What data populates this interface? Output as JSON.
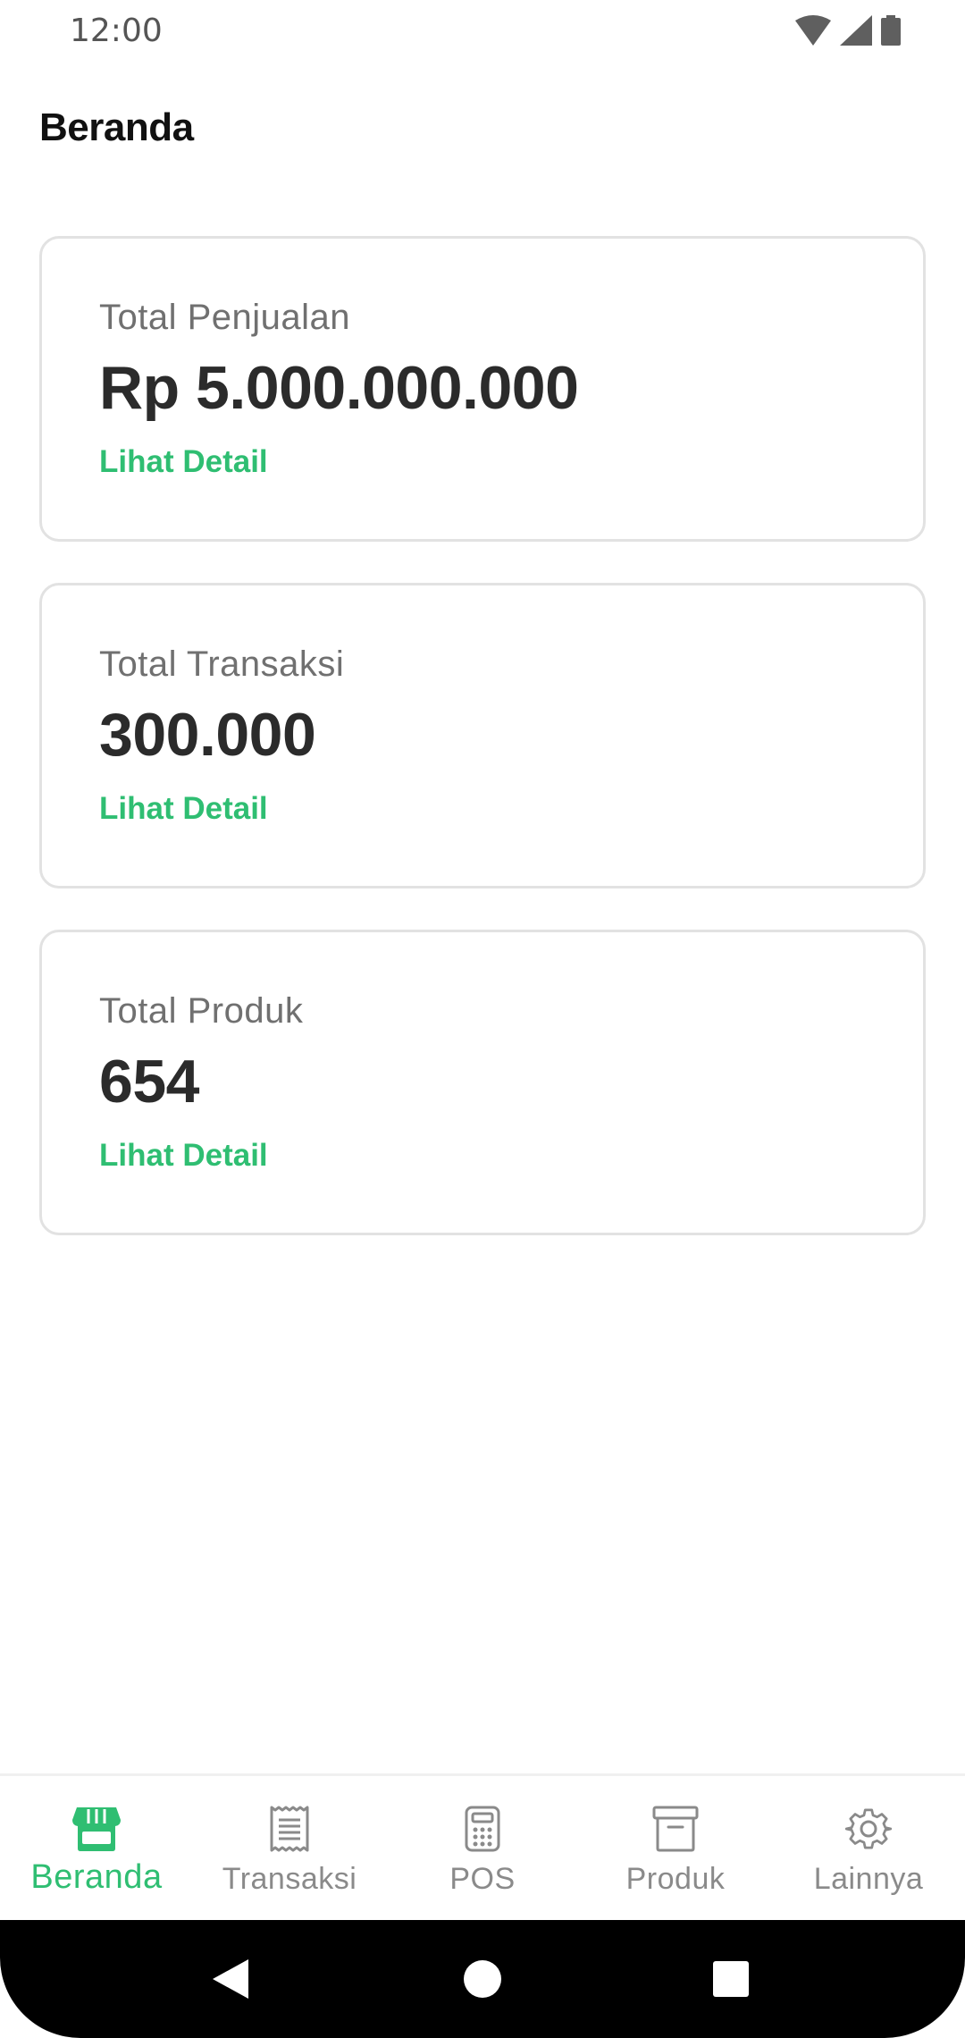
{
  "status_bar": {
    "time": "12:00"
  },
  "header": {
    "title": "Beranda"
  },
  "cards": [
    {
      "label": "Total Penjualan",
      "value": "Rp 5.000.000.000",
      "link": "Lihat Detail"
    },
    {
      "label": "Total Transaksi",
      "value": "300.000",
      "link": "Lihat Detail"
    },
    {
      "label": "Total Produk",
      "value": "654",
      "link": "Lihat Detail"
    }
  ],
  "bottom_nav": {
    "active": "Beranda",
    "items": [
      {
        "label": "Beranda",
        "icon": "store-icon"
      },
      {
        "label": "Transaksi",
        "icon": "receipt-icon"
      },
      {
        "label": "POS",
        "icon": "calculator-icon"
      },
      {
        "label": "Produk",
        "icon": "archive-box-icon"
      },
      {
        "label": "Lainnya",
        "icon": "gear-icon"
      }
    ]
  },
  "colors": {
    "accent": "#2fbe72",
    "inactive": "#8a8a8a",
    "text": "#2b2b2b",
    "border": "#e2e2e2"
  }
}
